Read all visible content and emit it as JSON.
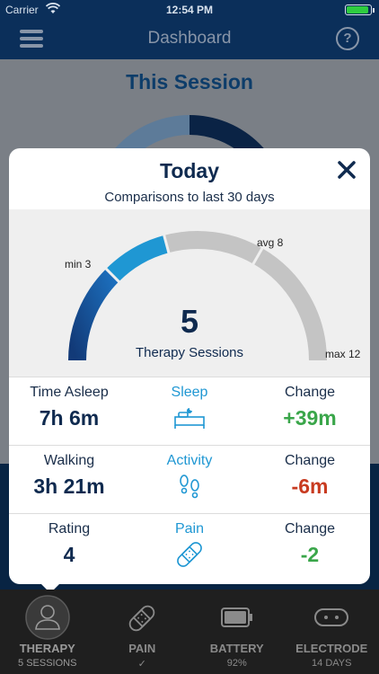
{
  "status_bar": {
    "carrier": "Carrier",
    "time": "12:54 PM"
  },
  "nav": {
    "title": "Dashboard"
  },
  "background": {
    "session_title": "This Session"
  },
  "modal": {
    "title": "Today",
    "subtitle": "Comparisons to last 30 days",
    "gauge": {
      "value": "5",
      "label": "Therapy Sessions",
      "min_label": "min 3",
      "avg_label": "avg 8",
      "max_label": "max 12",
      "min": 3,
      "avg": 8,
      "max": 12,
      "current": 5
    },
    "rows": [
      {
        "metric": "Time Asleep",
        "value": "7h 6m",
        "category": "Sleep",
        "icon": "bed-icon",
        "change_label": "Change",
        "change": "+39m",
        "trend": "pos"
      },
      {
        "metric": "Walking",
        "value": "3h 21m",
        "category": "Activity",
        "icon": "footprints-icon",
        "change_label": "Change",
        "change": "-6m",
        "trend": "neg"
      },
      {
        "metric": "Rating",
        "value": "4",
        "category": "Pain",
        "icon": "bandage-icon",
        "change_label": "Change",
        "change": "-2",
        "trend": "pos"
      }
    ]
  },
  "tabs": [
    {
      "label": "THERAPY",
      "sub": "5 SESSIONS",
      "icon": "person-icon",
      "active": true
    },
    {
      "label": "PAIN",
      "sub": "✓",
      "icon": "bandage-icon",
      "active": false
    },
    {
      "label": "BATTERY",
      "sub": "92%",
      "icon": "battery-icon",
      "active": false
    },
    {
      "label": "ELECTRODE",
      "sub": "14 DAYS",
      "icon": "electrode-icon",
      "active": false
    }
  ],
  "colors": {
    "navy": "#0f2a4f",
    "accent_blue": "#1f97d3",
    "positive": "#3aa64a",
    "negative": "#c83b20",
    "gauge_dark": "#123a78",
    "gauge_light": "#1f97d3",
    "gauge_gray": "#c4c4c4"
  }
}
